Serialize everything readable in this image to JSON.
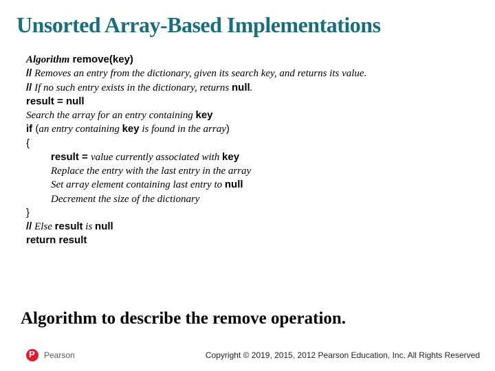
{
  "title": "Unsorted Array-Based Implementations",
  "algo": {
    "sig_lead": "Algorithm",
    "sig_name": " remove(key)",
    "c1_a": "//",
    "c1_b": " Removes an entry from the dictionary, given its search key, and returns its value.",
    "c2_a": "//",
    "c2_b": " If no such entry exists in the dictionary, returns ",
    "c2_c": "null",
    "c2_d": ".",
    "l3": "result = null",
    "l4_a": "Search the array for an entry containing ",
    "l4_b": "key",
    "l5_a": "if",
    "l5_b": " (",
    "l5_c": "an entry containing ",
    "l5_d": "key",
    "l5_e": " is found in the array",
    "l5_f": ")",
    "l6": "{",
    "l7_a": "result = ",
    "l7_b": "value currently associated with ",
    "l7_c": "key",
    "l8": "Replace the entry with the last entry in the array",
    "l9_a": "Set array element containing last entry to ",
    "l9_b": "null",
    "l10": "Decrement the size of the dictionary",
    "l11": "}",
    "l12_a": "//",
    "l12_b": " Else ",
    "l12_c": "result",
    "l12_d": " is ",
    "l12_e": "null",
    "l13": "return result"
  },
  "caption": "Algorithm to describe the remove operation.",
  "brand": "Pearson",
  "copyright": "Copyright © 2019, 2015, 2012 Pearson Education, Inc. All Rights Reserved"
}
